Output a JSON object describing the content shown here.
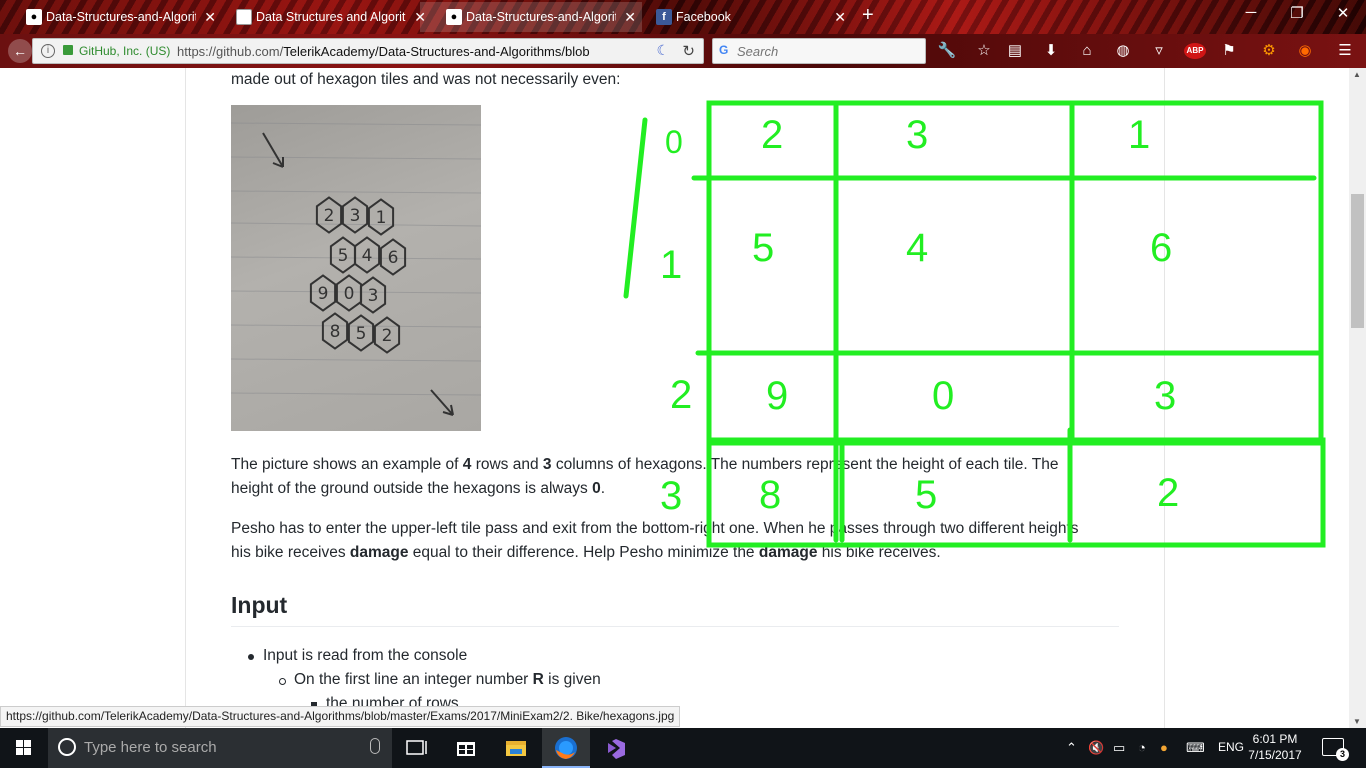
{
  "browser": {
    "tabs": [
      {
        "label": "Data-Structures-and-Algorit",
        "favicon": "github-icon",
        "active": false
      },
      {
        "label": "Data Structures and Algorith",
        "favicon": "page-icon",
        "active": false
      },
      {
        "label": "Data-Structures-and-Algorit",
        "favicon": "github-icon",
        "active": true
      },
      {
        "label": "Facebook",
        "favicon": "facebook-icon",
        "active": false
      }
    ],
    "identity": "GitHub, Inc. (US)",
    "url_prefix": "https://github.com/",
    "url_main": "TelerikAcademy/Data-Structures-and-Algorithms/blob",
    "search_placeholder": "Search",
    "status_url": "https://github.com/TelerikAcademy/Data-Structures-and-Algorithms/blob/master/Exams/2017/MiniExam2/2. Bike/hexagons.jpg",
    "abp_label": "ABP"
  },
  "page": {
    "intro_text": "made out of hexagon tiles and was not necessarily even:",
    "para1": {
      "t1": "The picture shows an example of ",
      "b1": "4",
      "t2": " rows and ",
      "b2": "3",
      "t3": " columns of hexagons. The numbers represent the height of each tile. The",
      "t4": "height of the ground outside the hexagons is always ",
      "b3": "0",
      "t5": "."
    },
    "para2": {
      "t1": "Pesho has to enter the upper-left tile pass and exit from the bottom-right one. When he passes through two different heights",
      "t2": "his bike receives ",
      "b1": "damage",
      "t3": " equal to their difference. Help Pesho minimize the ",
      "b2": "damage",
      "t4": " his bike receives."
    },
    "input_heading": "Input",
    "list": {
      "item1": "Input is read from the console",
      "item2_t1": "On the first line an integer number ",
      "item2_b": "R",
      "item2_t2": " is given",
      "item3": "the number of rows"
    },
    "photo_hex_labels": [
      "2",
      "3",
      "1",
      "5",
      "4",
      "6",
      "9",
      "0",
      "3",
      "8",
      "5",
      "2"
    ]
  },
  "overlay": {
    "color": "#22ee22",
    "row_labels": [
      "0",
      "1",
      "2",
      "3"
    ],
    "grid": [
      [
        "2",
        "3",
        "1"
      ],
      [
        "5",
        "4",
        "6"
      ],
      [
        "9",
        "0",
        "3"
      ],
      [
        "8",
        "5",
        "2"
      ]
    ]
  },
  "taskbar": {
    "search_placeholder": "Type here to search",
    "language": "ENG",
    "time": "6:01 PM",
    "date": "7/15/2017",
    "notification_count": "3"
  }
}
